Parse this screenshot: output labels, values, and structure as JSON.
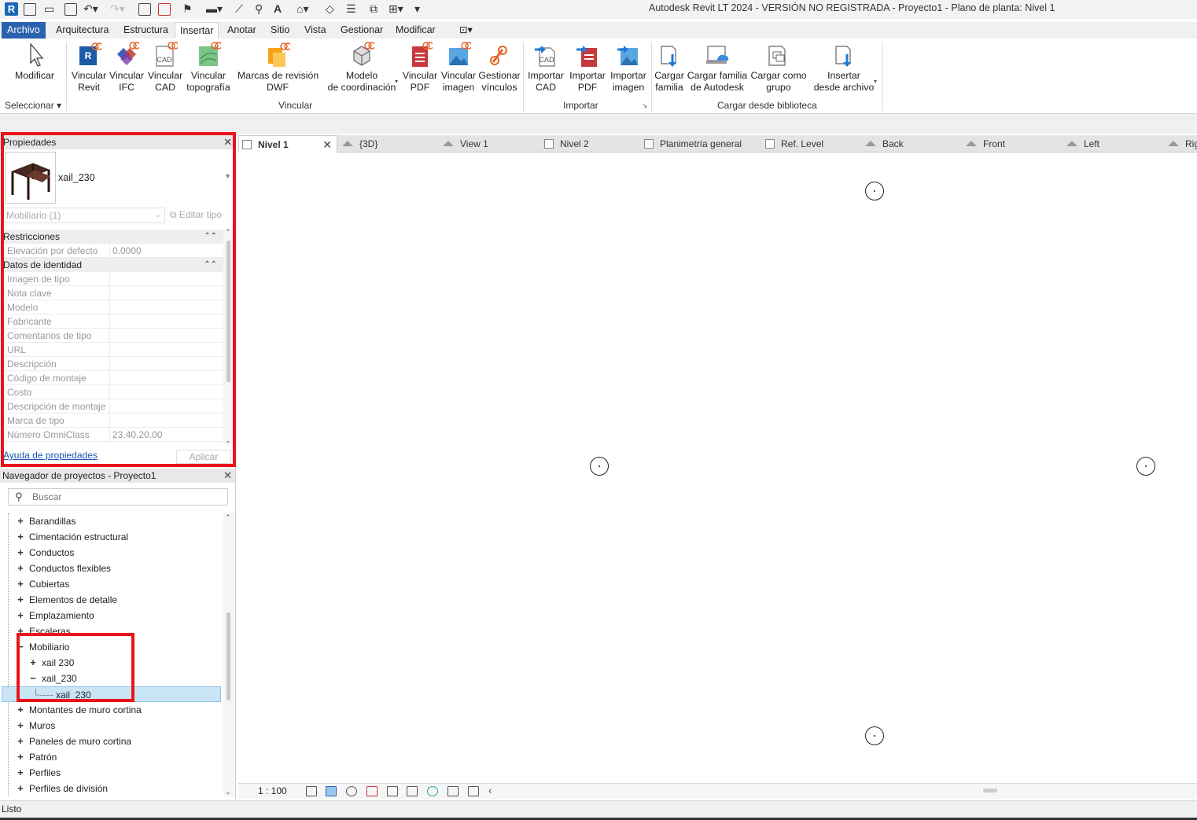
{
  "window": {
    "title": "Autodesk Revit LT 2024 - VERSIÓN NO REGISTRADA - Proyecto1 - Plano de planta: Nivel 1",
    "app_logo": "R"
  },
  "ribbon_tabs": [
    "Archivo",
    "Arquitectura",
    "Estructura",
    "Insertar",
    "Anotar",
    "Sitio",
    "Vista",
    "Gestionar",
    "Modificar"
  ],
  "ribbon_active_tab": "Insertar",
  "ribbon": {
    "select_panel_label": "Seleccionar",
    "vincular_panel_label": "Vincular",
    "importar_panel_label": "Importar",
    "biblioteca_panel_label": "Cargar desde biblioteca",
    "buttons": {
      "modificar": [
        "Modificar",
        ""
      ],
      "vincular_revit": [
        "Vincular",
        "Revit"
      ],
      "vincular_ifc": [
        "Vincular",
        "IFC"
      ],
      "vincular_cad": [
        "Vincular",
        "CAD"
      ],
      "vincular_topografia": [
        "Vincular",
        "topografía"
      ],
      "marcas_revision": [
        "Marcas de revisión",
        "DWF"
      ],
      "modelo_coordinacion": [
        "Modelo",
        "de coordinación"
      ],
      "vincular_pdf": [
        "Vincular",
        "PDF"
      ],
      "vincular_imagen": [
        "Vincular",
        "imagen"
      ],
      "gestionar_vinculos": [
        "Gestionar",
        "vínculos"
      ],
      "importar_cad": [
        "Importar",
        "CAD"
      ],
      "importar_pdf": [
        "Importar",
        "PDF"
      ],
      "importar_imagen": [
        "Importar",
        "imagen"
      ],
      "cargar_familia": [
        "Cargar",
        "familia"
      ],
      "cargar_familia_autodesk": [
        "Cargar familia",
        "de Autodesk"
      ],
      "cargar_como_grupo": [
        "Cargar como",
        "grupo"
      ],
      "insertar_desde_archivo": [
        "Insertar",
        "desde archivo"
      ]
    }
  },
  "properties": {
    "header": "Propiedades",
    "type_name": "xail_230",
    "filter_value": "Mobiliario (1)",
    "edit_type": "Editar tipo",
    "categories": [
      {
        "name": "Restricciones",
        "rows": [
          {
            "k": "Elevación por defecto",
            "v": "0.0000"
          }
        ]
      },
      {
        "name": "Datos de identidad",
        "rows": [
          {
            "k": "Imagen de tipo",
            "v": ""
          },
          {
            "k": "Nota clave",
            "v": ""
          },
          {
            "k": "Modelo",
            "v": ""
          },
          {
            "k": "Fabricante",
            "v": ""
          },
          {
            "k": "Comentarios de tipo",
            "v": ""
          },
          {
            "k": "URL",
            "v": ""
          },
          {
            "k": "Descripción",
            "v": ""
          },
          {
            "k": "Código de montaje",
            "v": ""
          },
          {
            "k": "Costo",
            "v": ""
          },
          {
            "k": "Descripción de montaje",
            "v": ""
          },
          {
            "k": "Marca de tipo",
            "v": ""
          },
          {
            "k": "Número OmniClass",
            "v": "23.40.20.00"
          }
        ]
      }
    ],
    "help_link": "Ayuda de propiedades",
    "apply": "Aplicar"
  },
  "browser": {
    "header": "Navegador de proyectos - Proyecto1",
    "search_placeholder": "Buscar",
    "items": [
      {
        "label": "Barandillas",
        "pm": "+"
      },
      {
        "label": "Cimentación estructural",
        "pm": "+"
      },
      {
        "label": "Conductos",
        "pm": "+"
      },
      {
        "label": "Conductos flexibles",
        "pm": "+"
      },
      {
        "label": "Cubiertas",
        "pm": "+"
      },
      {
        "label": "Elementos de detalle",
        "pm": "+"
      },
      {
        "label": "Emplazamiento",
        "pm": "+"
      },
      {
        "label": "Escaleras",
        "pm": "+"
      },
      {
        "label": "Mobiliario",
        "pm": "−"
      },
      {
        "label": "xail 230",
        "pm": "+"
      },
      {
        "label": "xail_230",
        "pm": "−"
      },
      {
        "label": "xail_230",
        "pm": ""
      },
      {
        "label": "Montantes de muro cortina",
        "pm": "+"
      },
      {
        "label": "Muros",
        "pm": "+"
      },
      {
        "label": "Paneles de muro cortina",
        "pm": "+"
      },
      {
        "label": "Patrón",
        "pm": "+"
      },
      {
        "label": "Perfiles",
        "pm": "+"
      },
      {
        "label": "Perfiles de división",
        "pm": "+"
      }
    ]
  },
  "view_tabs": [
    "Nivel 1",
    "{3D}",
    "View 1",
    "Nivel 2",
    "Planimetría general",
    "Ref. Level",
    "Back",
    "Front",
    "Left",
    "Rig"
  ],
  "view_bar": {
    "scale": "1 : 100"
  },
  "status": {
    "text": "Listo"
  },
  "colors": {
    "accent": "#2a62b0",
    "highlight_box": "#e8141a",
    "selected_row": "#c9e5f6"
  }
}
